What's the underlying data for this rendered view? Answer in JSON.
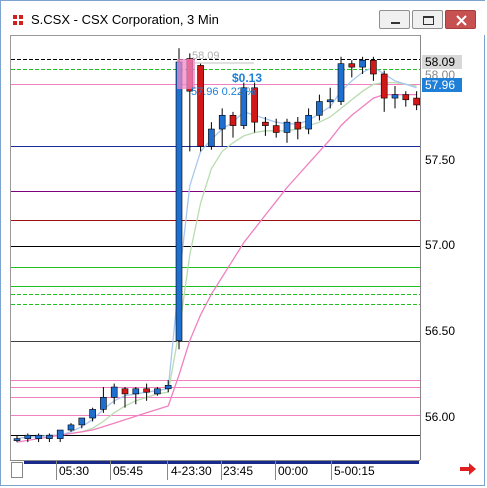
{
  "window": {
    "title": "S.CSX - CSX Corporation, 3 Min",
    "buttons": [
      "minimize",
      "restore",
      "close"
    ]
  },
  "price_axis": {
    "labels": [
      "58.09",
      "57.50",
      "57.00",
      "56.50",
      "56.00"
    ],
    "tags": [
      {
        "text": "58.09",
        "bg": "#d8d8d8",
        "color": "#000000"
      },
      {
        "text": "57.96",
        "bg": "#1e7fd8",
        "color": "#ffffff"
      }
    ]
  },
  "time_axis": {
    "labels": [
      "05:30",
      "05:45",
      "4-23:30",
      "23:45",
      "00:00",
      "5-00:15"
    ]
  },
  "annotations": {
    "change": "$0.13",
    "last_pct": "57.96 0.22 %",
    "prior_high": "58.09"
  },
  "colors": {
    "up_candle": "#1e6fd0",
    "down_candle": "#d01818",
    "ma_pink": "#f080c0",
    "ma_green": "#b8dcb0",
    "ma_blue": "#a8c8f0",
    "accent": "#1e7fd8"
  },
  "chart_data": {
    "type": "candlestick",
    "title": "S.CSX - CSX Corporation, 3 Min",
    "ylim": [
      55.9,
      58.2
    ],
    "categories": [
      "05:30",
      "05:45",
      "4-23:30",
      "23:45",
      "00:00",
      "5-00:15"
    ],
    "candles": [
      {
        "o": 55.88,
        "h": 55.9,
        "l": 55.86,
        "c": 55.88
      },
      {
        "o": 55.88,
        "h": 55.91,
        "l": 55.86,
        "c": 55.9
      },
      {
        "o": 55.88,
        "h": 55.91,
        "l": 55.86,
        "c": 55.9
      },
      {
        "o": 55.88,
        "h": 55.91,
        "l": 55.86,
        "c": 55.9
      },
      {
        "o": 55.88,
        "h": 55.93,
        "l": 55.86,
        "c": 55.93
      },
      {
        "o": 55.93,
        "h": 55.97,
        "l": 55.92,
        "c": 55.96
      },
      {
        "o": 55.96,
        "h": 56.0,
        "l": 55.94,
        "c": 56.0
      },
      {
        "o": 56.0,
        "h": 56.06,
        "l": 55.98,
        "c": 56.05
      },
      {
        "o": 56.05,
        "h": 56.18,
        "l": 56.03,
        "c": 56.12
      },
      {
        "o": 56.12,
        "h": 56.2,
        "l": 56.08,
        "c": 56.18
      },
      {
        "o": 56.17,
        "h": 56.18,
        "l": 56.06,
        "c": 56.14
      },
      {
        "o": 56.14,
        "h": 56.18,
        "l": 56.08,
        "c": 56.17
      },
      {
        "o": 56.17,
        "h": 56.2,
        "l": 56.1,
        "c": 56.15
      },
      {
        "o": 56.14,
        "h": 56.18,
        "l": 56.13,
        "c": 56.17
      },
      {
        "o": 56.17,
        "h": 56.22,
        "l": 56.15,
        "c": 56.19
      },
      {
        "o": 56.45,
        "h": 58.15,
        "l": 56.4,
        "c": 58.07
      },
      {
        "o": 58.09,
        "h": 58.12,
        "l": 57.55,
        "c": 57.9
      },
      {
        "o": 58.05,
        "h": 58.06,
        "l": 57.55,
        "c": 57.58
      },
      {
        "o": 57.58,
        "h": 57.72,
        "l": 57.56,
        "c": 57.68
      },
      {
        "o": 57.68,
        "h": 57.8,
        "l": 57.58,
        "c": 57.76
      },
      {
        "o": 57.76,
        "h": 57.78,
        "l": 57.63,
        "c": 57.7
      },
      {
        "o": 57.7,
        "h": 57.95,
        "l": 57.68,
        "c": 57.92
      },
      {
        "o": 57.92,
        "h": 57.95,
        "l": 57.66,
        "c": 57.72
      },
      {
        "o": 57.72,
        "h": 57.75,
        "l": 57.64,
        "c": 57.7
      },
      {
        "o": 57.7,
        "h": 57.74,
        "l": 57.63,
        "c": 57.66
      },
      {
        "o": 57.66,
        "h": 57.74,
        "l": 57.6,
        "c": 57.72
      },
      {
        "o": 57.72,
        "h": 57.75,
        "l": 57.62,
        "c": 57.68
      },
      {
        "o": 57.68,
        "h": 57.8,
        "l": 57.65,
        "c": 57.76
      },
      {
        "o": 57.76,
        "h": 57.88,
        "l": 57.73,
        "c": 57.84
      },
      {
        "o": 57.84,
        "h": 57.92,
        "l": 57.8,
        "c": 57.85
      },
      {
        "o": 57.84,
        "h": 58.1,
        "l": 57.82,
        "c": 58.06
      },
      {
        "o": 58.06,
        "h": 58.08,
        "l": 57.98,
        "c": 58.04
      },
      {
        "o": 58.04,
        "h": 58.1,
        "l": 58.0,
        "c": 58.08
      },
      {
        "o": 58.08,
        "h": 58.1,
        "l": 57.96,
        "c": 58.0
      },
      {
        "o": 58.0,
        "h": 58.02,
        "l": 57.78,
        "c": 57.86
      },
      {
        "o": 57.86,
        "h": 57.93,
        "l": 57.8,
        "c": 57.88
      },
      {
        "o": 57.88,
        "h": 57.9,
        "l": 57.81,
        "c": 57.85
      },
      {
        "o": 57.86,
        "h": 57.9,
        "l": 57.79,
        "c": 57.82
      }
    ],
    "hlines": [
      {
        "y": 58.09,
        "color": "#000000",
        "dash": "4,2"
      },
      {
        "y": 58.03,
        "color": "#20c020",
        "dash": "4,2"
      },
      {
        "y": 57.94,
        "color": "#f080c0",
        "dash": "0"
      },
      {
        "y": 57.58,
        "color": "#1a2a9a",
        "dash": "0"
      },
      {
        "y": 57.32,
        "color": "#800080",
        "dash": "0"
      },
      {
        "y": 57.15,
        "color": "#a01010",
        "dash": "0"
      },
      {
        "y": 57.0,
        "color": "#000000",
        "dash": "0"
      },
      {
        "y": 56.88,
        "color": "#20c020",
        "dash": "0"
      },
      {
        "y": 56.77,
        "color": "#20c020",
        "dash": "0"
      },
      {
        "y": 56.72,
        "color": "#20c020",
        "dash": "4,2"
      },
      {
        "y": 56.66,
        "color": "#20c020",
        "dash": "4,2"
      },
      {
        "y": 56.45,
        "color": "#404040",
        "dash": "0"
      },
      {
        "y": 56.22,
        "color": "#f080c0",
        "dash": "0"
      },
      {
        "y": 56.18,
        "color": "#f080c0",
        "dash": "0"
      },
      {
        "y": 56.12,
        "color": "#f080c0",
        "dash": "0"
      },
      {
        "y": 56.02,
        "color": "#f080c0",
        "dash": "0"
      },
      {
        "y": 55.9,
        "color": "#000000",
        "dash": "0"
      }
    ],
    "ma_pink": [
      55.86,
      55.87,
      55.88,
      55.89,
      55.9,
      55.91,
      55.92,
      55.93,
      55.95,
      55.97,
      55.99,
      56.01,
      56.03,
      56.05,
      56.07,
      56.25,
      56.45,
      56.6,
      56.72,
      56.82,
      56.92,
      57.02,
      57.1,
      57.18,
      57.26,
      57.34,
      57.41,
      57.48,
      57.55,
      57.62,
      57.7,
      57.76,
      57.81,
      57.86,
      57.88,
      57.88,
      57.88,
      57.88
    ],
    "ma_green": [
      55.88,
      55.89,
      55.89,
      55.9,
      55.9,
      55.91,
      55.92,
      55.94,
      55.98,
      56.03,
      56.07,
      56.1,
      56.12,
      56.14,
      56.15,
      56.5,
      56.95,
      57.25,
      57.45,
      57.55,
      57.6,
      57.64,
      57.66,
      57.67,
      57.67,
      57.67,
      57.68,
      57.7,
      57.72,
      57.75,
      57.8,
      57.85,
      57.9,
      57.94,
      57.95,
      57.95,
      57.94,
      57.93
    ],
    "ma_blue": [
      55.88,
      55.89,
      55.89,
      55.9,
      55.9,
      55.92,
      55.95,
      55.99,
      56.05,
      56.1,
      56.13,
      56.14,
      56.15,
      56.16,
      56.17,
      56.8,
      57.35,
      57.55,
      57.62,
      57.68,
      57.72,
      57.78,
      57.76,
      57.74,
      57.72,
      57.71,
      57.71,
      57.73,
      57.77,
      57.81,
      57.9,
      57.96,
      58.01,
      58.04,
      58.0,
      57.96,
      57.94,
      57.92
    ]
  }
}
